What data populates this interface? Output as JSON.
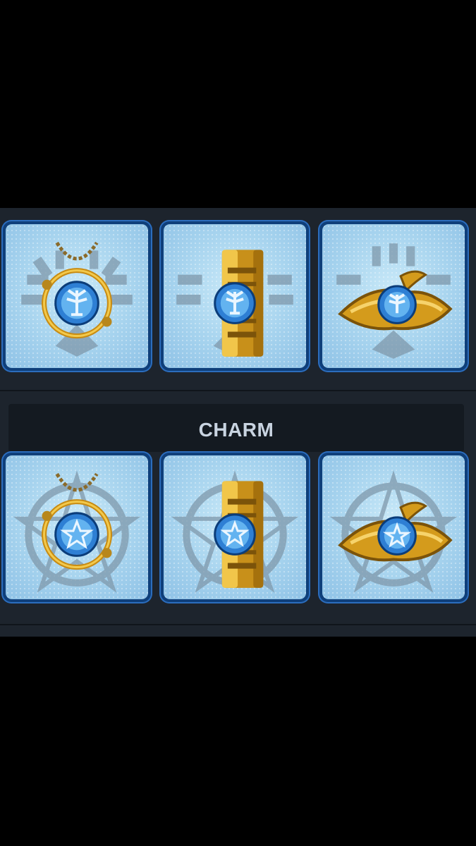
{
  "section_label": "CHARM",
  "rows": [
    {
      "emblem": "radiant-sun-emblem",
      "items": [
        {
          "icon": "pendant-icon",
          "gem": "tree-gem-icon"
        },
        {
          "icon": "bracelet-icon",
          "gem": "tree-gem-icon"
        },
        {
          "icon": "ring-icon",
          "gem": "tree-gem-icon"
        }
      ]
    },
    {
      "emblem": "star-emblem",
      "items": [
        {
          "icon": "pendant-icon",
          "gem": "star-gem-icon"
        },
        {
          "icon": "bracelet-icon",
          "gem": "star-gem-icon"
        },
        {
          "icon": "ring-icon",
          "gem": "star-gem-icon"
        }
      ]
    }
  ],
  "colors": {
    "panel": "#1d242d",
    "card_border": "#0f3f7a",
    "card_fill": "#a6d3ee",
    "gold": "#d9a21d",
    "gem": "#3b8fe0",
    "label": "#c9d4e1"
  }
}
